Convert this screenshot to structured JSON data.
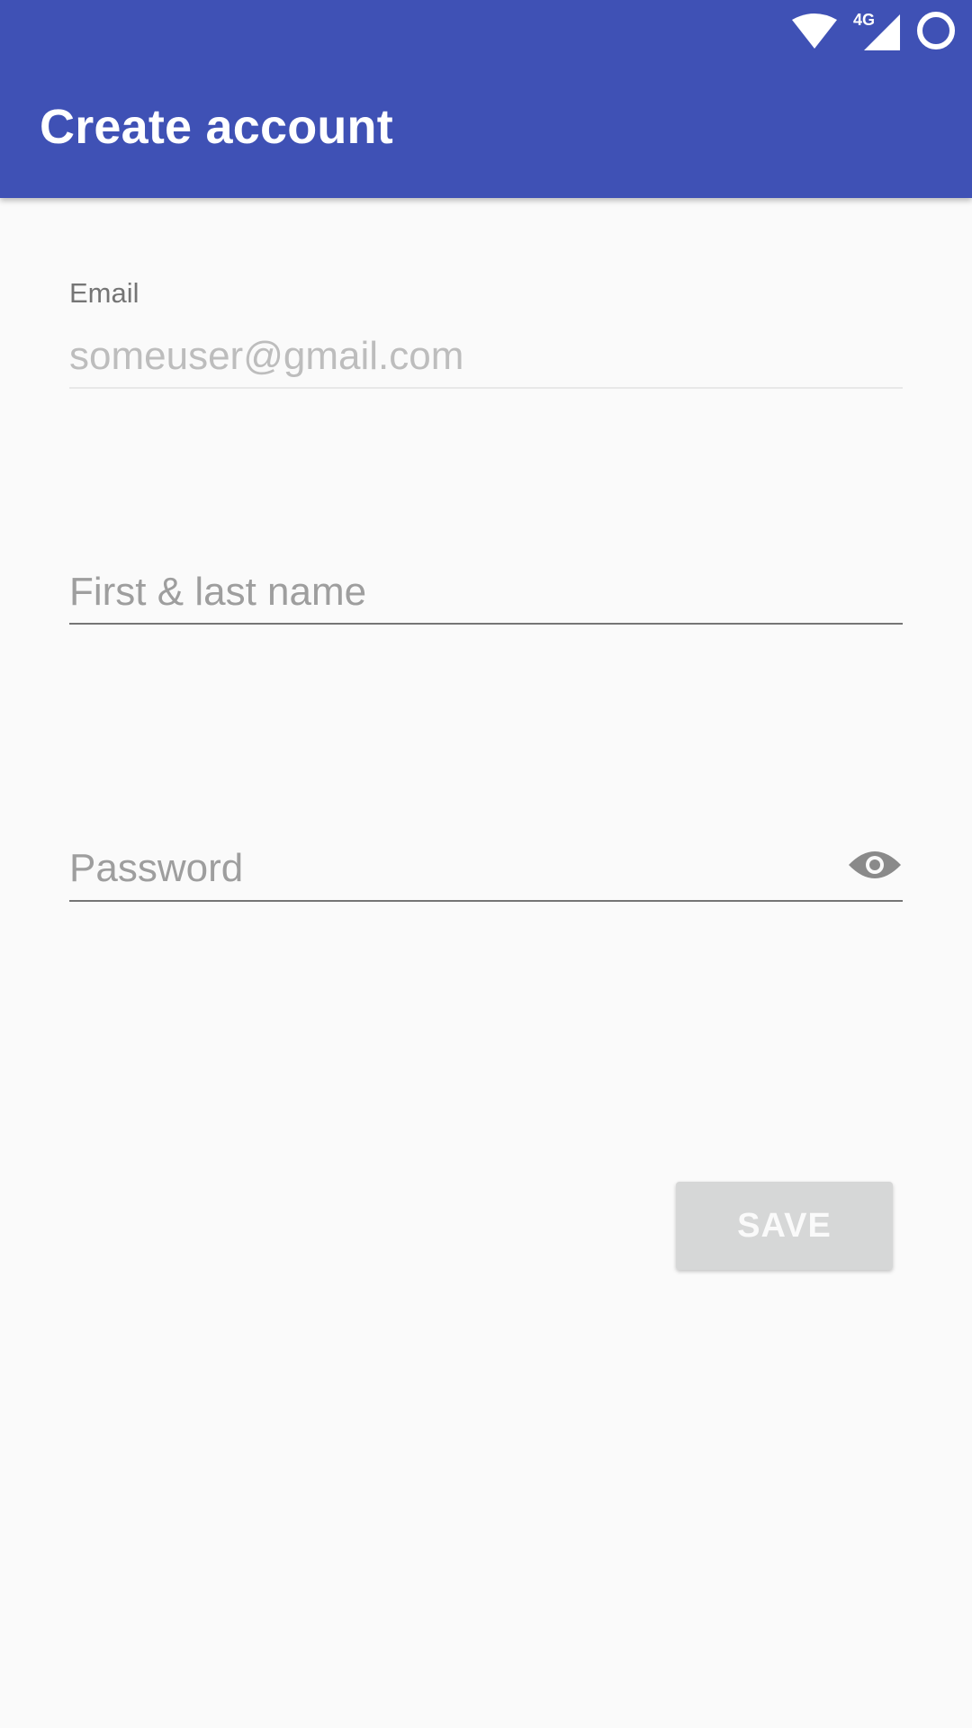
{
  "status_bar": {
    "network_label": "4G",
    "icons": [
      "wifi-icon",
      "signal-4g-icon",
      "circle-status-icon"
    ]
  },
  "app_bar": {
    "title": "Create account",
    "color": "#3f51b5"
  },
  "form": {
    "email": {
      "label": "Email",
      "value": "someuser@gmail.com"
    },
    "name": {
      "placeholder": "First & last name"
    },
    "password": {
      "placeholder": "Password",
      "toggle_icon": "eye-icon"
    }
  },
  "actions": {
    "save_label": "SAVE",
    "enabled": false
  }
}
